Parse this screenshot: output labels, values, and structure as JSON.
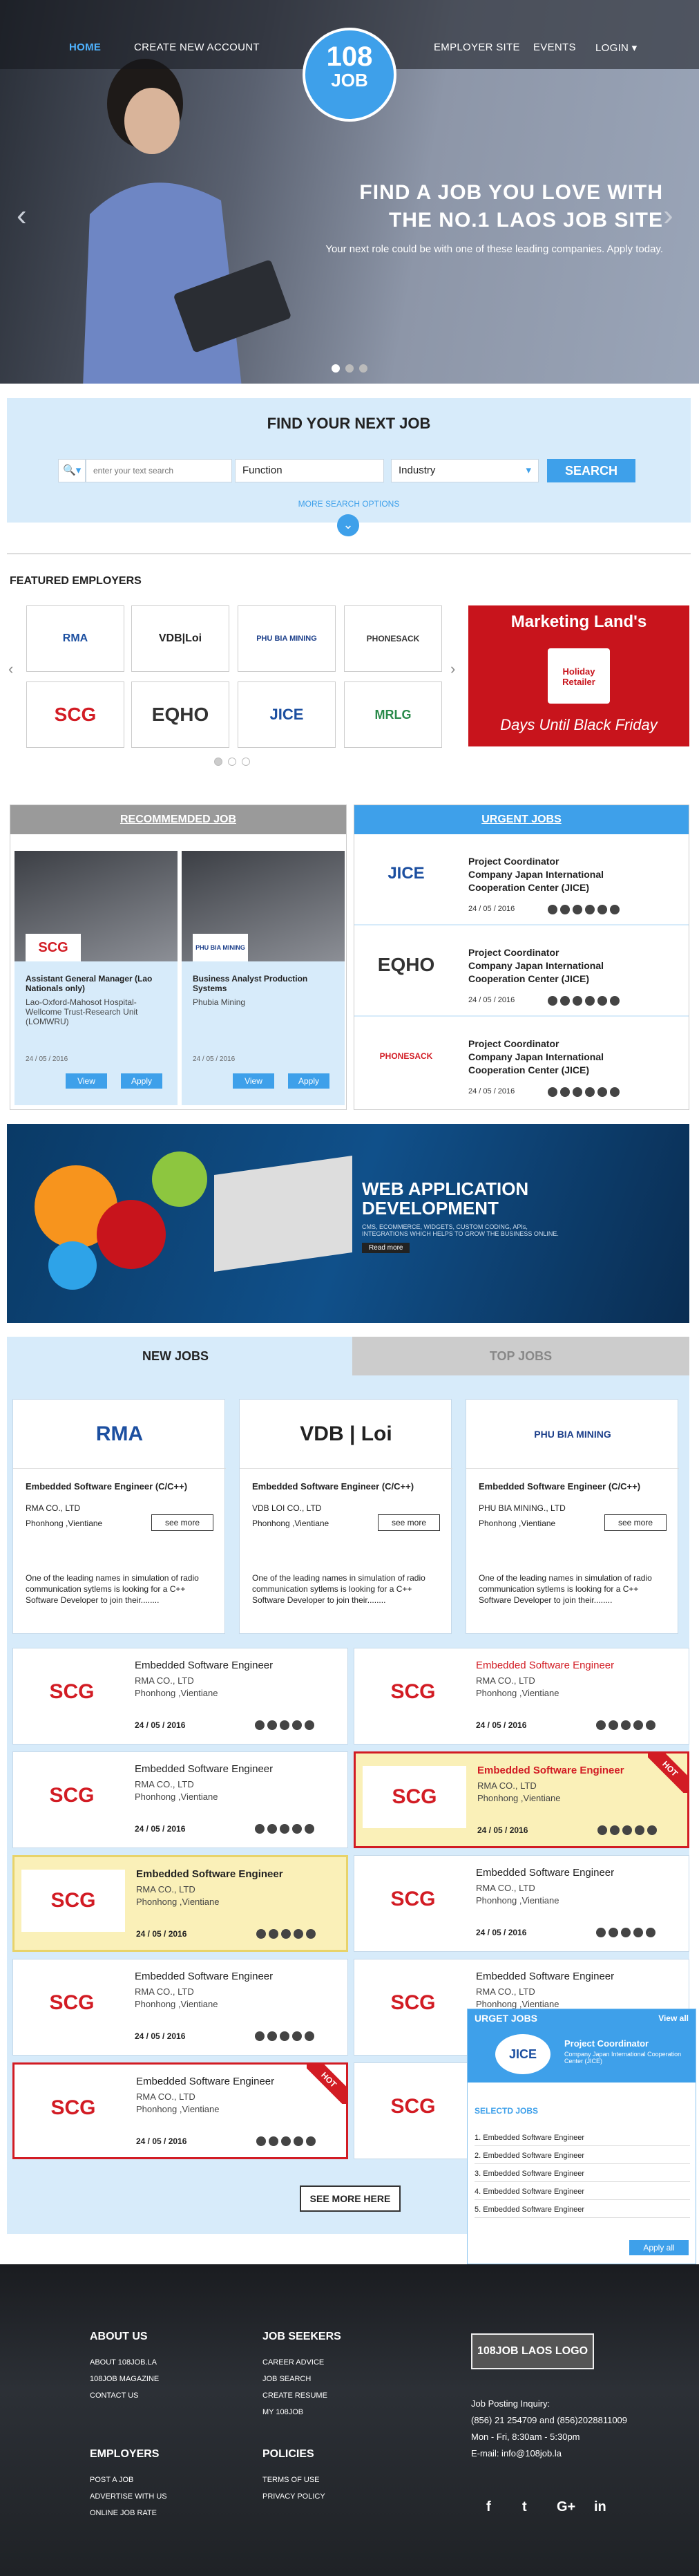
{
  "nav": {
    "home": "HOME",
    "create_account": "CREATE NEW ACCOUNT",
    "employer_site": "EMPLOYER SITE",
    "events": "EVENTS",
    "login": "LOGIN"
  },
  "logo": {
    "number": "108",
    "word": "JOB"
  },
  "hero": {
    "title_line1": "FIND A JOB YOU LOVE WITH",
    "title_line2": "THE NO.1 LAOS JOB SITE",
    "subtitle": "Your next role could be with one of these leading companies. Apply today."
  },
  "search": {
    "title": "FIND YOUR NEXT JOB",
    "placeholder": "enter your text search",
    "function": "Function",
    "industry": "Industry",
    "button": "SEARCH",
    "more_options": "MORE SEARCH OPTIONS"
  },
  "featured": {
    "heading": "FEATURED EMPLOYERS",
    "employers": [
      "RMA",
      "VDB|Loi",
      "PHU BIA MINING",
      "PHONESACK",
      "SCG",
      "EQHO",
      "JICE",
      "MRLG"
    ],
    "ad": {
      "title": "Marketing Land's",
      "badge": "Holiday Retailer",
      "bottom": "Days Until Black Friday"
    }
  },
  "recommended": {
    "heading": "RECOMMEMDED JOB",
    "cards": [
      {
        "title": "Assistant General Manager (Lao Nationals only)",
        "company": "Lao-Oxford-Mahosot Hospital-Wellcome Trust-Research Unit (LOMWRU)",
        "date": "24 / 05 / 2016",
        "view": "View",
        "apply": "Apply",
        "logo": "SCG"
      },
      {
        "title": "Business Analyst Production Systems",
        "company": "Phubia Mining",
        "date": "24 / 05 / 2016",
        "view": "View",
        "apply": "Apply",
        "logo": "PHU BIA MINING"
      }
    ]
  },
  "urgent": {
    "heading": "URGENT JOBS",
    "items": [
      {
        "title": "Project Coordinator\nCompany Japan International Cooperation Center (JICE)",
        "date": "24 / 05 / 2016",
        "logo": "JICE"
      },
      {
        "title": "Project Coordinator\nCompany Japan International Cooperation Center (JICE)",
        "date": "24 / 05 / 2016",
        "logo": "EQHO"
      },
      {
        "title": "Project Coordinator\nCompany Japan International Cooperation Center (JICE)",
        "date": "24 / 05 / 2016",
        "logo": "PHONESACK"
      }
    ]
  },
  "banner": {
    "title": "WEB APPLICATION\nDEVELOPMENT",
    "sub": "CMS, ECOMMERCE, WIDGETS, CUSTOM CODING, APIs,\nINTEGRATIONS WHICH HELPS TO GROW THE BUSINESS ONLINE.",
    "btn": "Read more"
  },
  "newjobs": {
    "tab_new": "NEW JOBS",
    "tab_top": "TOP JOBS",
    "cards": [
      {
        "logo": "RMA",
        "title": "Embedded Software Engineer (C/C++)",
        "company": "RMA CO., LTD",
        "location": "Phonhong ,Vientiane",
        "see": "see more",
        "desc": "One of the leading names in simulation of radio communication sytlems is looking for a C++ Software Developer to join their........"
      },
      {
        "logo": "VDB | Loi",
        "title": "Embedded Software Engineer (C/C++)",
        "company": "VDB LOI CO., LTD",
        "location": "Phonhong ,Vientiane",
        "see": "see more",
        "desc": "One of the leading names in simulation of radio communication sytlems is looking for a C++ Software Developer to join their........"
      },
      {
        "logo": "PHU BIA MINING",
        "title": "Embedded Software Engineer (C/C++)",
        "company": "PHU BIA MINING., LTD",
        "location": "Phonhong ,Vientiane",
        "see": "see more",
        "desc": "One of the leading names in simulation of radio communication sytlems is looking for a C++ Software Developer to join their........"
      }
    ],
    "list": [
      {
        "title": "Embedded Software Engineer",
        "company": "RMA CO., LTD",
        "location": "Phonhong ,Vientiane",
        "date": "24 / 05 / 2016",
        "logo": "SCG",
        "hot": ""
      },
      {
        "title": "Embedded Software Engineer",
        "company": "RMA CO., LTD",
        "location": "Phonhong ,Vientiane",
        "date": "24 / 05 / 2016",
        "logo": "SCG",
        "hot": ""
      },
      {
        "title": "Embedded Software Engineer",
        "company": "RMA CO., LTD",
        "location": "Phonhong ,Vientiane",
        "date": "24 / 05 / 2016",
        "logo": "SCG",
        "hot": ""
      },
      {
        "title": "Embedded Software Engineer",
        "company": "RMA CO., LTD",
        "location": "Phonhong ,Vientiane",
        "date": "24 / 05 / 2016",
        "logo": "SCG",
        "hot": "HOT"
      },
      {
        "title": "Embedded Software Engineer",
        "company": "RMA CO., LTD",
        "location": "Phonhong ,Vientiane",
        "date": "24 / 05 / 2016",
        "logo": "SCG",
        "hot": ""
      },
      {
        "title": "Embedded Software Engineer",
        "company": "RMA CO., LTD",
        "location": "Phonhong ,Vientiane",
        "date": "24 / 05 / 2016",
        "logo": "SCG",
        "hot": ""
      },
      {
        "title": "Embedded Software Engineer",
        "company": "RMA CO., LTD",
        "location": "Phonhong ,Vientiane",
        "date": "24 / 05 / 2016",
        "logo": "SCG",
        "hot": ""
      },
      {
        "title": "Embedded Software Engineer",
        "company": "RMA CO., LTD",
        "location": "Phonhong ,Vientiane",
        "date": "24 / 05 / 2016",
        "logo": "SCG",
        "hot": ""
      },
      {
        "title": "Embedded Software Engineer",
        "company": "RMA CO., LTD",
        "location": "Phonhong ,Vientiane",
        "date": "24 / 05 / 2016",
        "logo": "SCG",
        "hot": "HOT"
      },
      {
        "title": "Embedded Software Engineer",
        "company": "RMA CO., LTD",
        "location": "Phonhong ,Vientiane",
        "date": "24 / 05 / 2016",
        "logo": "SCG",
        "hot": ""
      }
    ],
    "see_more": "SEE MORE HERE"
  },
  "widget": {
    "urgent": "URGET JOBS",
    "view_all": "View all",
    "job_title": "Project Coordinator",
    "job_company": "Company Japan International Cooperation Center (JICE)",
    "selected": "SELECTD JOBS",
    "items": [
      "1. Embedded Software Engineer",
      "2. Embedded Software Engineer",
      "3. Embedded Software Engineer",
      "4. Embedded Software Engineer",
      "5. Embedded Software Engineer"
    ],
    "apply_all": "Apply all"
  },
  "footer": {
    "about": "ABOUT US",
    "about_links": [
      "ABOUT 108JOB.LA",
      "108JOB MAGAZINE",
      "CONTACT US"
    ],
    "seekers": "JOB SEEKERS",
    "seeker_links": [
      "CAREER ADVICE",
      "JOB SEARCH",
      "CREATE RESUME",
      "MY 108JOB"
    ],
    "employers": "EMPLOYERS",
    "employer_links": [
      "POST A JOB",
      "ADVERTISE WITH US",
      "ONLINE JOB RATE"
    ],
    "policies": "POLICIES",
    "policy_links": [
      "TERMS OF USE",
      "PRIVACY POLICY"
    ],
    "logo": "108JOB LAOS LOGO",
    "info": [
      "Job Posting Inquiry:",
      "(856) 21 254709 and (856)2028811009",
      "Mon - Fri, 8:30am - 5:30pm",
      "E-mail: info@108job.la"
    ]
  }
}
